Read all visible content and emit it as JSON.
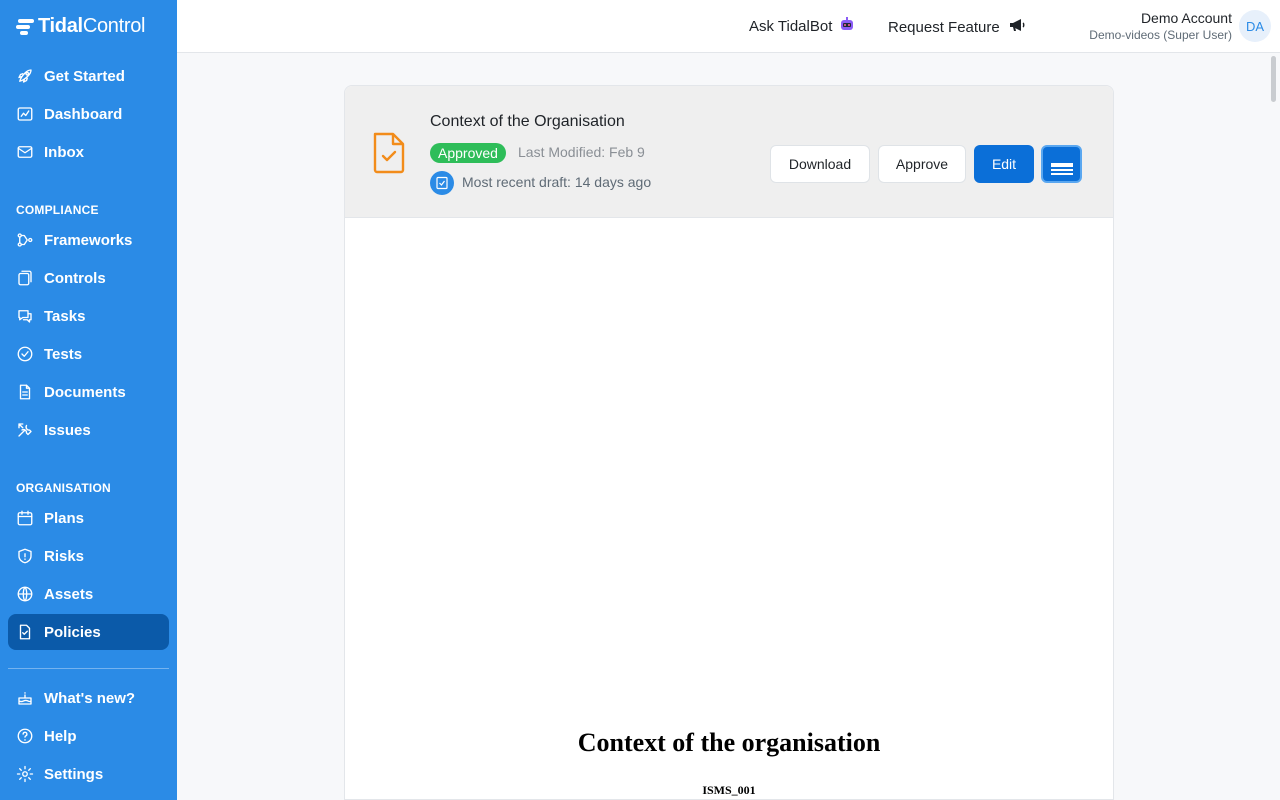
{
  "brand": {
    "name_bold": "Tidal",
    "name_rest": "Control"
  },
  "sidebar": {
    "items": [
      {
        "label": "Get Started",
        "icon": "rocket-icon"
      },
      {
        "label": "Dashboard",
        "icon": "chart-icon"
      },
      {
        "label": "Inbox",
        "icon": "mail-icon"
      }
    ],
    "compliance_title": "COMPLIANCE",
    "compliance": [
      {
        "label": "Frameworks",
        "icon": "framework-icon"
      },
      {
        "label": "Controls",
        "icon": "controls-icon"
      },
      {
        "label": "Tasks",
        "icon": "chat-icon"
      },
      {
        "label": "Tests",
        "icon": "check-circle-icon"
      },
      {
        "label": "Documents",
        "icon": "document-icon"
      },
      {
        "label": "Issues",
        "icon": "tools-icon"
      }
    ],
    "organisation_title": "ORGANISATION",
    "organisation": [
      {
        "label": "Plans",
        "icon": "calendar-icon"
      },
      {
        "label": "Risks",
        "icon": "shield-icon"
      },
      {
        "label": "Assets",
        "icon": "globe-icon"
      },
      {
        "label": "Policies",
        "icon": "policy-icon",
        "active": true
      }
    ],
    "footer": [
      {
        "label": "What's new?",
        "icon": "cake-icon"
      },
      {
        "label": "Help",
        "icon": "help-icon"
      },
      {
        "label": "Settings",
        "icon": "gear-icon"
      }
    ]
  },
  "topbar": {
    "ask_label": "Ask TidalBot",
    "request_label": "Request Feature",
    "account_name": "Demo Account",
    "account_role": "Demo-videos (Super User)",
    "avatar_initials": "DA"
  },
  "document": {
    "title": "Context of the Organisation",
    "status": "Approved",
    "modified": "Last Modified: Feb 9",
    "draft": "Most recent draft: 14 days ago",
    "buttons": {
      "download": "Download",
      "approve": "Approve",
      "edit": "Edit"
    },
    "heading": "Context of the organisation",
    "code": "ISMS_001"
  },
  "colors": {
    "sidebar": "#2b8be6",
    "active": "#0b5aa9",
    "approved": "#2ebd59",
    "primary": "#0b6fd8",
    "doc_icon": "#f28c1a"
  }
}
